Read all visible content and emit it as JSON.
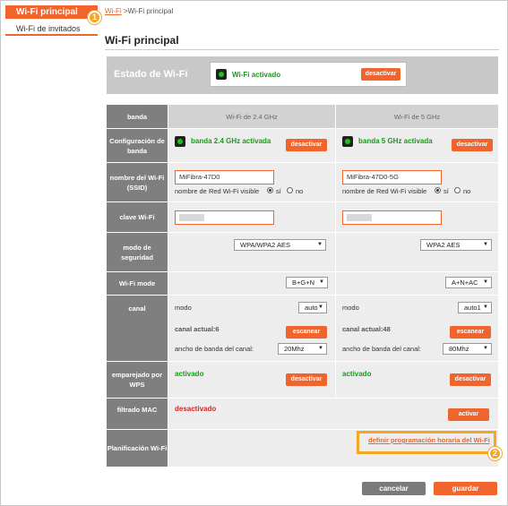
{
  "nav": {
    "main": "Wi-Fi principal",
    "guest": "Wi-Fi de invitados"
  },
  "breadcrumb": {
    "link": "Wi-Fi",
    "sep_current": " >Wi-Fi principal"
  },
  "page_title": "Wi-Fi principal",
  "badges": {
    "one": "1",
    "two": "2"
  },
  "status": {
    "title": "Estado de Wi-Fi",
    "state": "Wi-Fi activado",
    "button": "desactivar"
  },
  "table": {
    "header": {
      "label": "banda",
      "col1": "Wi-Fi de 2.4 GHz",
      "col2": "Wi-Fi de 5 GHz"
    },
    "config": {
      "label": "Configuración de banda",
      "col1_state": "banda 2.4 GHz activada",
      "col2_state": "banda 5 GHz activada",
      "button": "desactivar"
    },
    "ssid": {
      "label": "nombre del Wi-Fi (SSID)",
      "col1_value": "MiFibra-47D0",
      "col2_value": "MiFibra-47D0-5G",
      "visible_label": "nombre de Red Wi-Fi visible",
      "yes": "sí",
      "no": "no",
      "col1_visible": "sí",
      "col2_visible": "sí"
    },
    "key": {
      "label": "clave Wi-Fi"
    },
    "security": {
      "label": "modo de seguridad",
      "col1_value": "WPA/WPA2 AES",
      "col2_value": "WPA2 AES"
    },
    "mode": {
      "label": "Wi-Fi mode",
      "col1_value": "B+G+N",
      "col2_value": "A+N+AC"
    },
    "channel": {
      "label": "canal",
      "mode_label": "modo",
      "col1_mode": "auto",
      "col2_mode": "auto1",
      "col1_current": "canal actual:6",
      "col2_current": "canal actual:48",
      "scan_button": "escanear",
      "bw_label": "ancho de banda del canal:",
      "col1_bw": "20Mhz",
      "col2_bw": "80Mhz"
    },
    "wps": {
      "label": "emparejado por WPS",
      "col1_state": "activado",
      "col2_state": "activado",
      "button": "desactivar"
    },
    "mac": {
      "label": "filtrado MAC",
      "state": "desactivado",
      "button": "activar"
    },
    "schedule": {
      "label": "Planificación Wi-Fi",
      "link": "definir programación horaria del Wi-Fi"
    }
  },
  "footer": {
    "cancel": "cancelar",
    "save": "guardar"
  },
  "colors": {
    "accent": "#f0642d",
    "highlight": "#f5a623",
    "ok": "#179c17",
    "off": "#e02020",
    "label_bg": "#7f7f7f"
  }
}
